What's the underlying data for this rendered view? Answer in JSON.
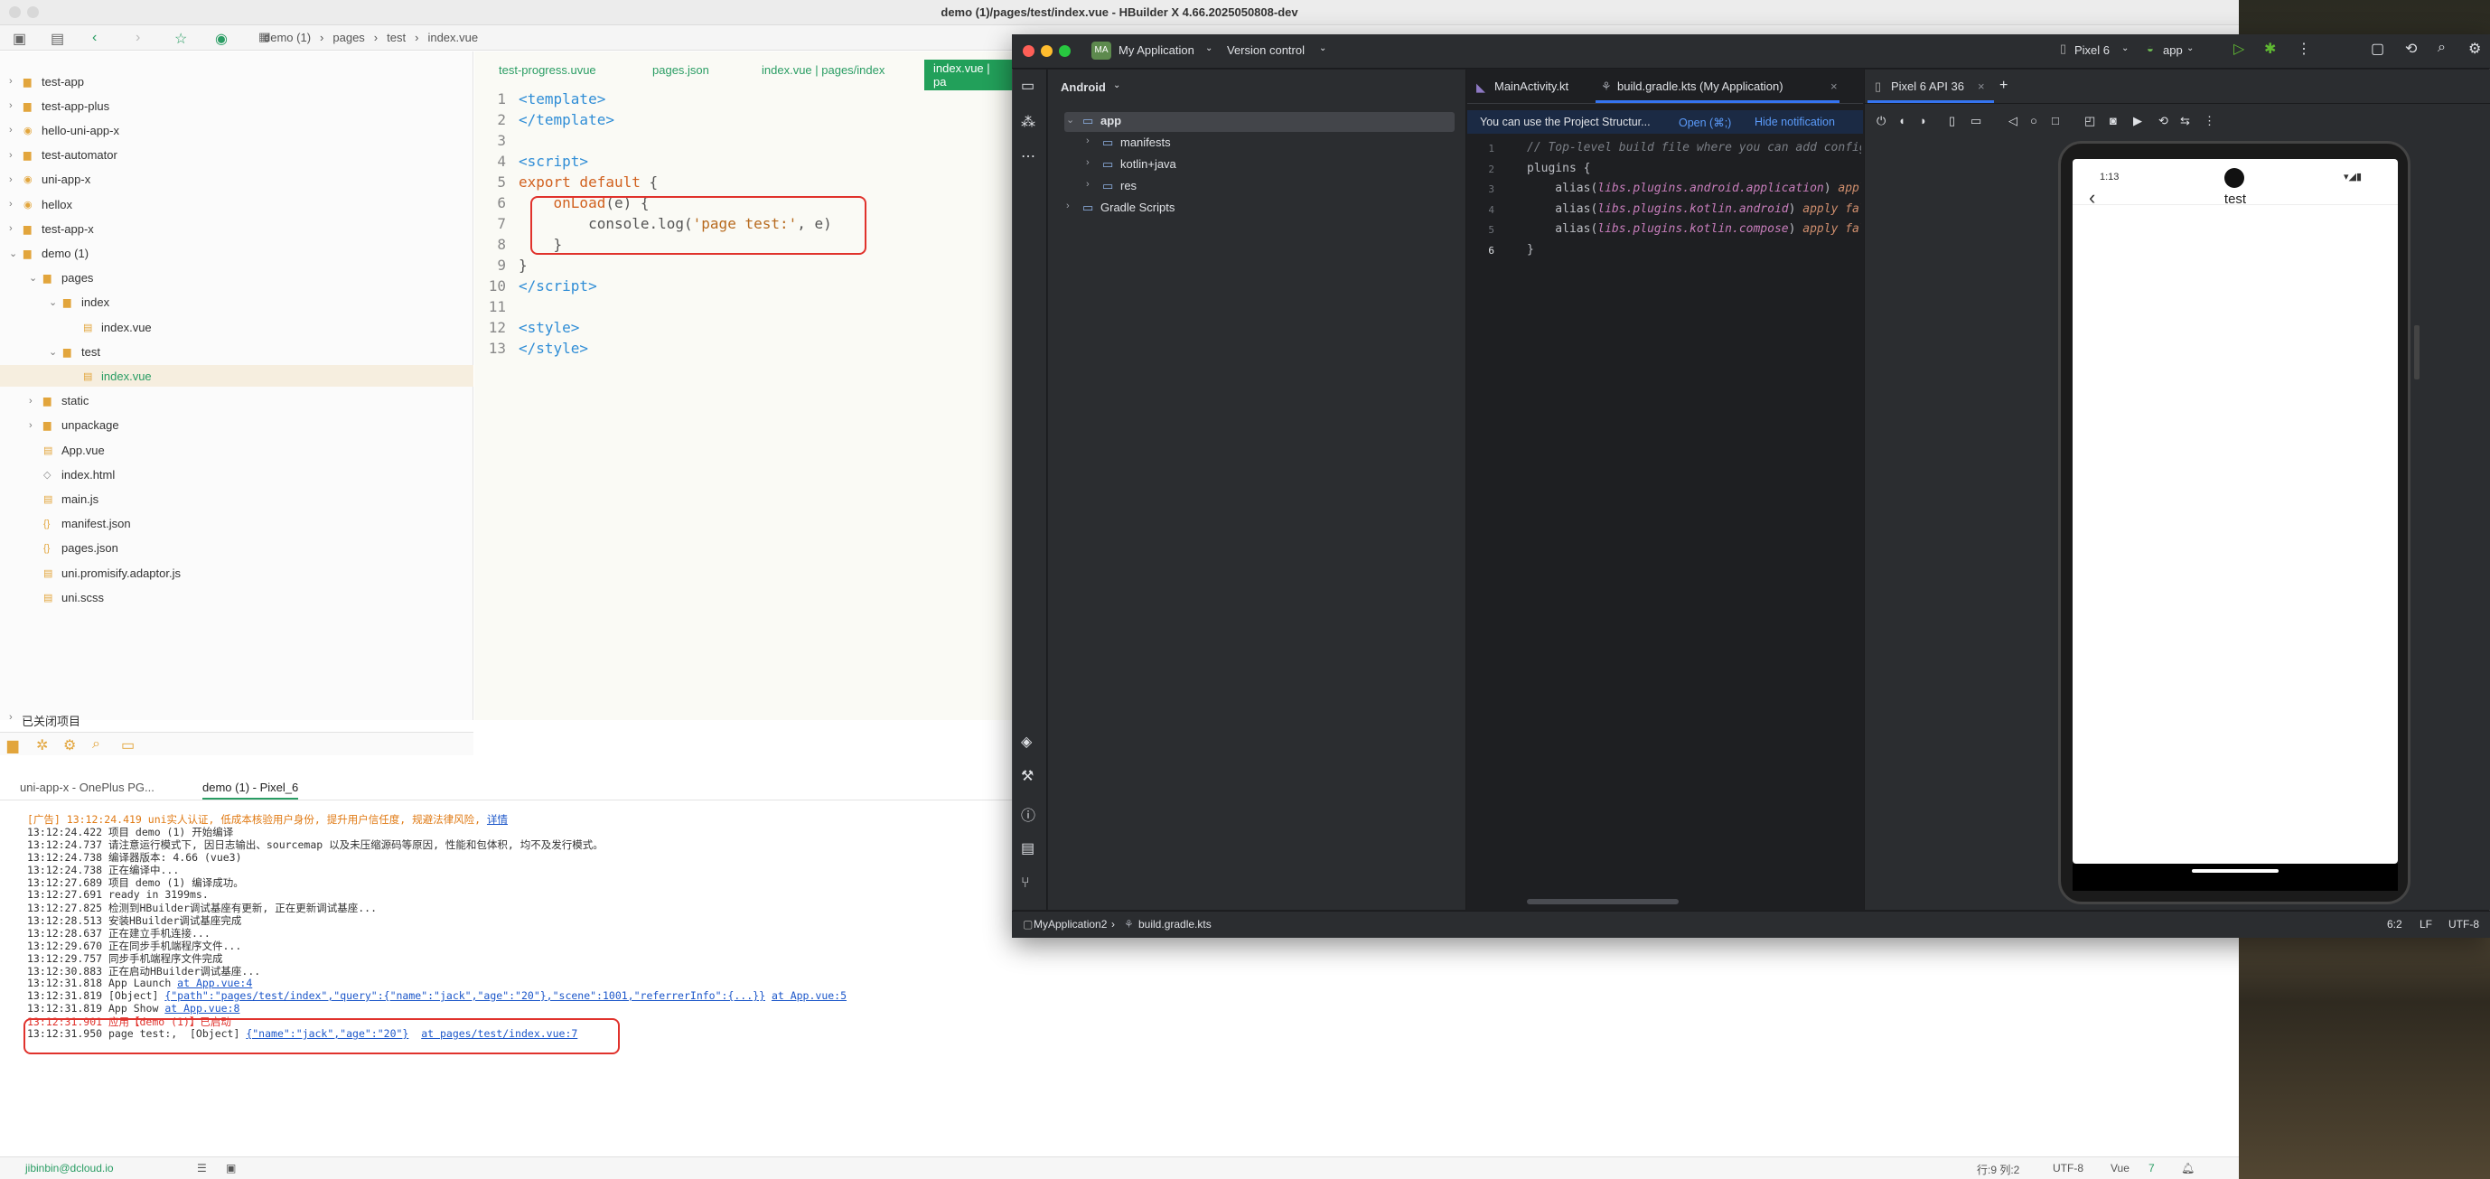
{
  "hbuilder": {
    "window_title": "demo (1)/pages/test/index.vue - HBuilder X 4.66.2025050808-dev",
    "breadcrumb": [
      "demo (1)",
      "pages",
      "test",
      "index.vue"
    ],
    "tree": [
      {
        "label": "test-app",
        "level": 0,
        "arrow": "›",
        "icon": "folder-icon"
      },
      {
        "label": "test-app-plus",
        "level": 0,
        "arrow": "›",
        "icon": "folder-icon"
      },
      {
        "label": "hello-uni-app-x",
        "level": 0,
        "arrow": "›",
        "icon": "uni-icon"
      },
      {
        "label": "test-automator",
        "level": 0,
        "arrow": "›",
        "icon": "folder-icon"
      },
      {
        "label": "uni-app-x",
        "level": 0,
        "arrow": "›",
        "icon": "uni-icon"
      },
      {
        "label": "hellox",
        "level": 0,
        "arrow": "›",
        "icon": "uni-icon"
      },
      {
        "label": "test-app-x",
        "level": 0,
        "arrow": "›",
        "icon": "folder-icon"
      },
      {
        "label": "demo (1)",
        "level": 0,
        "arrow": "⌄",
        "icon": "folder-icon"
      },
      {
        "label": "pages",
        "level": 1,
        "arrow": "⌄",
        "icon": "folder-icon"
      },
      {
        "label": "index",
        "level": 2,
        "arrow": "⌄",
        "icon": "folder-icon"
      },
      {
        "label": "index.vue",
        "level": 3,
        "arrow": "",
        "icon": "file-icon"
      },
      {
        "label": "test",
        "level": 2,
        "arrow": "⌄",
        "icon": "folder-icon"
      },
      {
        "label": "index.vue",
        "level": 3,
        "arrow": "",
        "icon": "file-icon",
        "selected": true
      },
      {
        "label": "static",
        "level": 1,
        "arrow": "›",
        "icon": "folder-icon"
      },
      {
        "label": "unpackage",
        "level": 1,
        "arrow": "›",
        "icon": "folder-icon"
      },
      {
        "label": "App.vue",
        "level": 1,
        "arrow": "",
        "icon": "file-icon"
      },
      {
        "label": "index.html",
        "level": 1,
        "arrow": "",
        "icon": "code-icon"
      },
      {
        "label": "main.js",
        "level": 1,
        "arrow": "",
        "icon": "file-icon"
      },
      {
        "label": "manifest.json",
        "level": 1,
        "arrow": "",
        "icon": "json-icon"
      },
      {
        "label": "pages.json",
        "level": 1,
        "arrow": "",
        "icon": "json-icon"
      },
      {
        "label": "uni.promisify.adaptor.js",
        "level": 1,
        "arrow": "",
        "icon": "file-icon"
      },
      {
        "label": "uni.scss",
        "level": 1,
        "arrow": "",
        "icon": "file-icon"
      }
    ],
    "closed_projects": "已关闭项目",
    "editor_tabs": [
      "test-progress.uvue",
      "pages.json",
      "index.vue | pages/index",
      "index.vue | pa"
    ],
    "code_lines": [
      {
        "n": "1",
        "html": "<span class='tag'>&lt;template&gt;</span>"
      },
      {
        "n": "2",
        "html": "<span class='tag'>&lt;/template&gt;</span>"
      },
      {
        "n": "3",
        "html": ""
      },
      {
        "n": "4",
        "html": "<span class='tag'>&lt;script&gt;</span>"
      },
      {
        "n": "5",
        "html": "<span class='kw'>export default</span> {"
      },
      {
        "n": "6",
        "html": "    <span class='kw'>onLoad</span>(e) {"
      },
      {
        "n": "7",
        "html": "        console.log(<span class='str'>'page test:'</span>, e)"
      },
      {
        "n": "8",
        "html": "    }"
      },
      {
        "n": "9",
        "html": "}"
      },
      {
        "n": "10",
        "html": "<span class='tag'>&lt;/script&gt;</span>"
      },
      {
        "n": "11",
        "html": ""
      },
      {
        "n": "12",
        "html": "<span class='tag'>&lt;style&gt;</span>"
      },
      {
        "n": "13",
        "html": "<span class='tag'>&lt;/style&gt;</span>"
      }
    ],
    "console_tabs": [
      "uni-app-x - OnePlus PG...",
      "demo (1) - Pixel_6"
    ],
    "console_lines": [
      {
        "html": "<span class='orange'>[广告] 13:12:24.419 uni实人认证, 低成本核验用户身份, 提升用户信任度, 规避法律风险,</span> <span class='lnk'>详情</span>"
      },
      {
        "html": "13:12:24.422 项目 demo (1) 开始编译"
      },
      {
        "html": "13:12:24.737 请注意运行模式下, 因日志输出、sourcemap 以及未压缩源码等原因, 性能和包体积, 均不及发行模式。"
      },
      {
        "html": "13:12:24.738 编译器版本: 4.66 (vue3)"
      },
      {
        "html": "13:12:24.738 正在编译中..."
      },
      {
        "html": "13:12:27.689 项目 demo (1) 编译成功。"
      },
      {
        "html": "13:12:27.691 ready in 3199ms."
      },
      {
        "html": "13:12:27.825 检测到HBuilder调试基座有更新, 正在更新调试基座..."
      },
      {
        "html": "13:12:28.513 安装HBuilder调试基座完成"
      },
      {
        "html": "13:12:28.637 正在建立手机连接..."
      },
      {
        "html": "13:12:29.670 正在同步手机端程序文件..."
      },
      {
        "html": "13:12:29.757 同步手机端程序文件完成"
      },
      {
        "html": "13:12:30.883 正在启动HBuilder调试基座..."
      },
      {
        "html": "13:12:31.818 App Launch <span class='lnk'>at App.vue:4</span>"
      },
      {
        "html": "13:12:31.819 [Object] <span class='lnk'>{\"path\":\"pages/test/index\",\"query\":{\"name\":\"jack\",\"age\":\"20\"},\"scene\":1001,\"referrerInfo\":{...}}</span> <span class='lnk'>at App.vue:5</span>"
      },
      {
        "html": "13:12:31.819 App Show <span class='lnk'>at App.vue:8</span>"
      },
      {
        "html": "<span class='red'>13:12:31.901 应用【demo (1)】已启动</span>"
      },
      {
        "html": "13:12:31.950 page test:,  [Object] <span class='lnk'>{\"name\":\"jack\",\"age\":\"20\"}</span>  <span class='lnk'>at pages/test/index.vue:7</span>"
      }
    ],
    "status": {
      "user": "jibinbin@dcloud.io",
      "position": "行:9  列:2",
      "encoding": "UTF-8",
      "language": "Vue",
      "count": "7"
    }
  },
  "android_studio": {
    "project_badge": "MA",
    "project": "My Application",
    "vcs": "Version control",
    "device": "Pixel 6",
    "run_config": "app",
    "view_mode": "Android",
    "tree": [
      {
        "label": "app",
        "level": 0,
        "arrow": "⌄"
      },
      {
        "label": "manifests",
        "level": 1,
        "arrow": "›"
      },
      {
        "label": "kotlin+java",
        "level": 1,
        "arrow": "›"
      },
      {
        "label": "res",
        "level": 1,
        "arrow": "›"
      },
      {
        "label": "Gradle Scripts",
        "level": 0,
        "arrow": "›"
      }
    ],
    "editor_tabs": [
      "MainActivity.kt",
      "build.gradle.kts (My Application)"
    ],
    "notification": "You can use the Project Structur...",
    "notification_open": "Open (⌘;)",
    "notification_hide": "Hide notification",
    "code_lines": [
      {
        "n": "1",
        "html": "<span class='cmt'>// Top-level build file where you can add configuration options common to all sub-projects/modules.</span>"
      },
      {
        "n": "2",
        "html": "plugins {"
      },
      {
        "n": "3",
        "html": "    alias(<span class='pl'>libs.plugins.android.application</span>) <span class='ap'>apply false</span>"
      },
      {
        "n": "4",
        "html": "    alias(<span class='pl'>libs.plugins.kotlin.android</span>) <span class='ap'>apply false</span>"
      },
      {
        "n": "5",
        "html": "    alias(<span class='pl'>libs.plugins.kotlin.compose</span>) <span class='ap'>apply false</span>"
      },
      {
        "n": "6",
        "html": "}"
      }
    ],
    "emulator_tab": "Pixel 6 API 36",
    "phone_time": "1:13",
    "phone_title": "test",
    "status_path": [
      "MyApplication2",
      "build.gradle.kts"
    ],
    "status_right": [
      "6:2",
      "LF",
      "UTF-8"
    ]
  }
}
